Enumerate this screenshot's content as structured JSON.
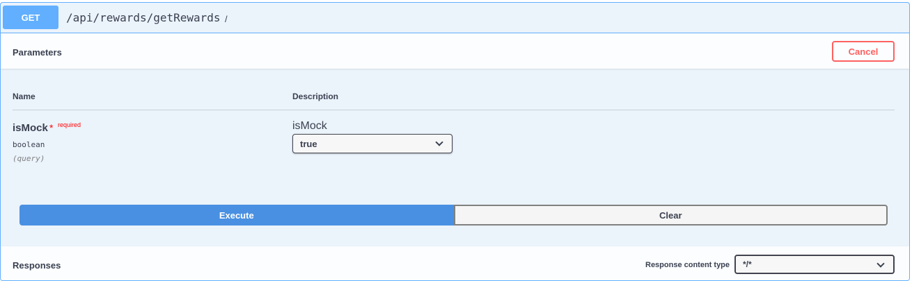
{
  "summary": {
    "method": "GET",
    "path": "/api/rewards/getRewards",
    "description": "/"
  },
  "parameters": {
    "title": "Parameters",
    "cancel_label": "Cancel",
    "columns": {
      "name": "Name",
      "description": "Description"
    },
    "items": [
      {
        "name": "isMock",
        "required_star": "*",
        "required_label": "required",
        "type": "boolean",
        "in": "(query)",
        "description": "isMock",
        "selected_value": "true"
      }
    ]
  },
  "actions": {
    "execute_label": "Execute",
    "clear_label": "Clear"
  },
  "responses": {
    "title": "Responses",
    "content_type_label": "Response content type",
    "content_type_value": "*/*"
  },
  "colors": {
    "get_accent": "#61affe",
    "cancel": "#ff6060",
    "execute": "#4990e2"
  },
  "icons": [
    "chevron-down-icon"
  ]
}
